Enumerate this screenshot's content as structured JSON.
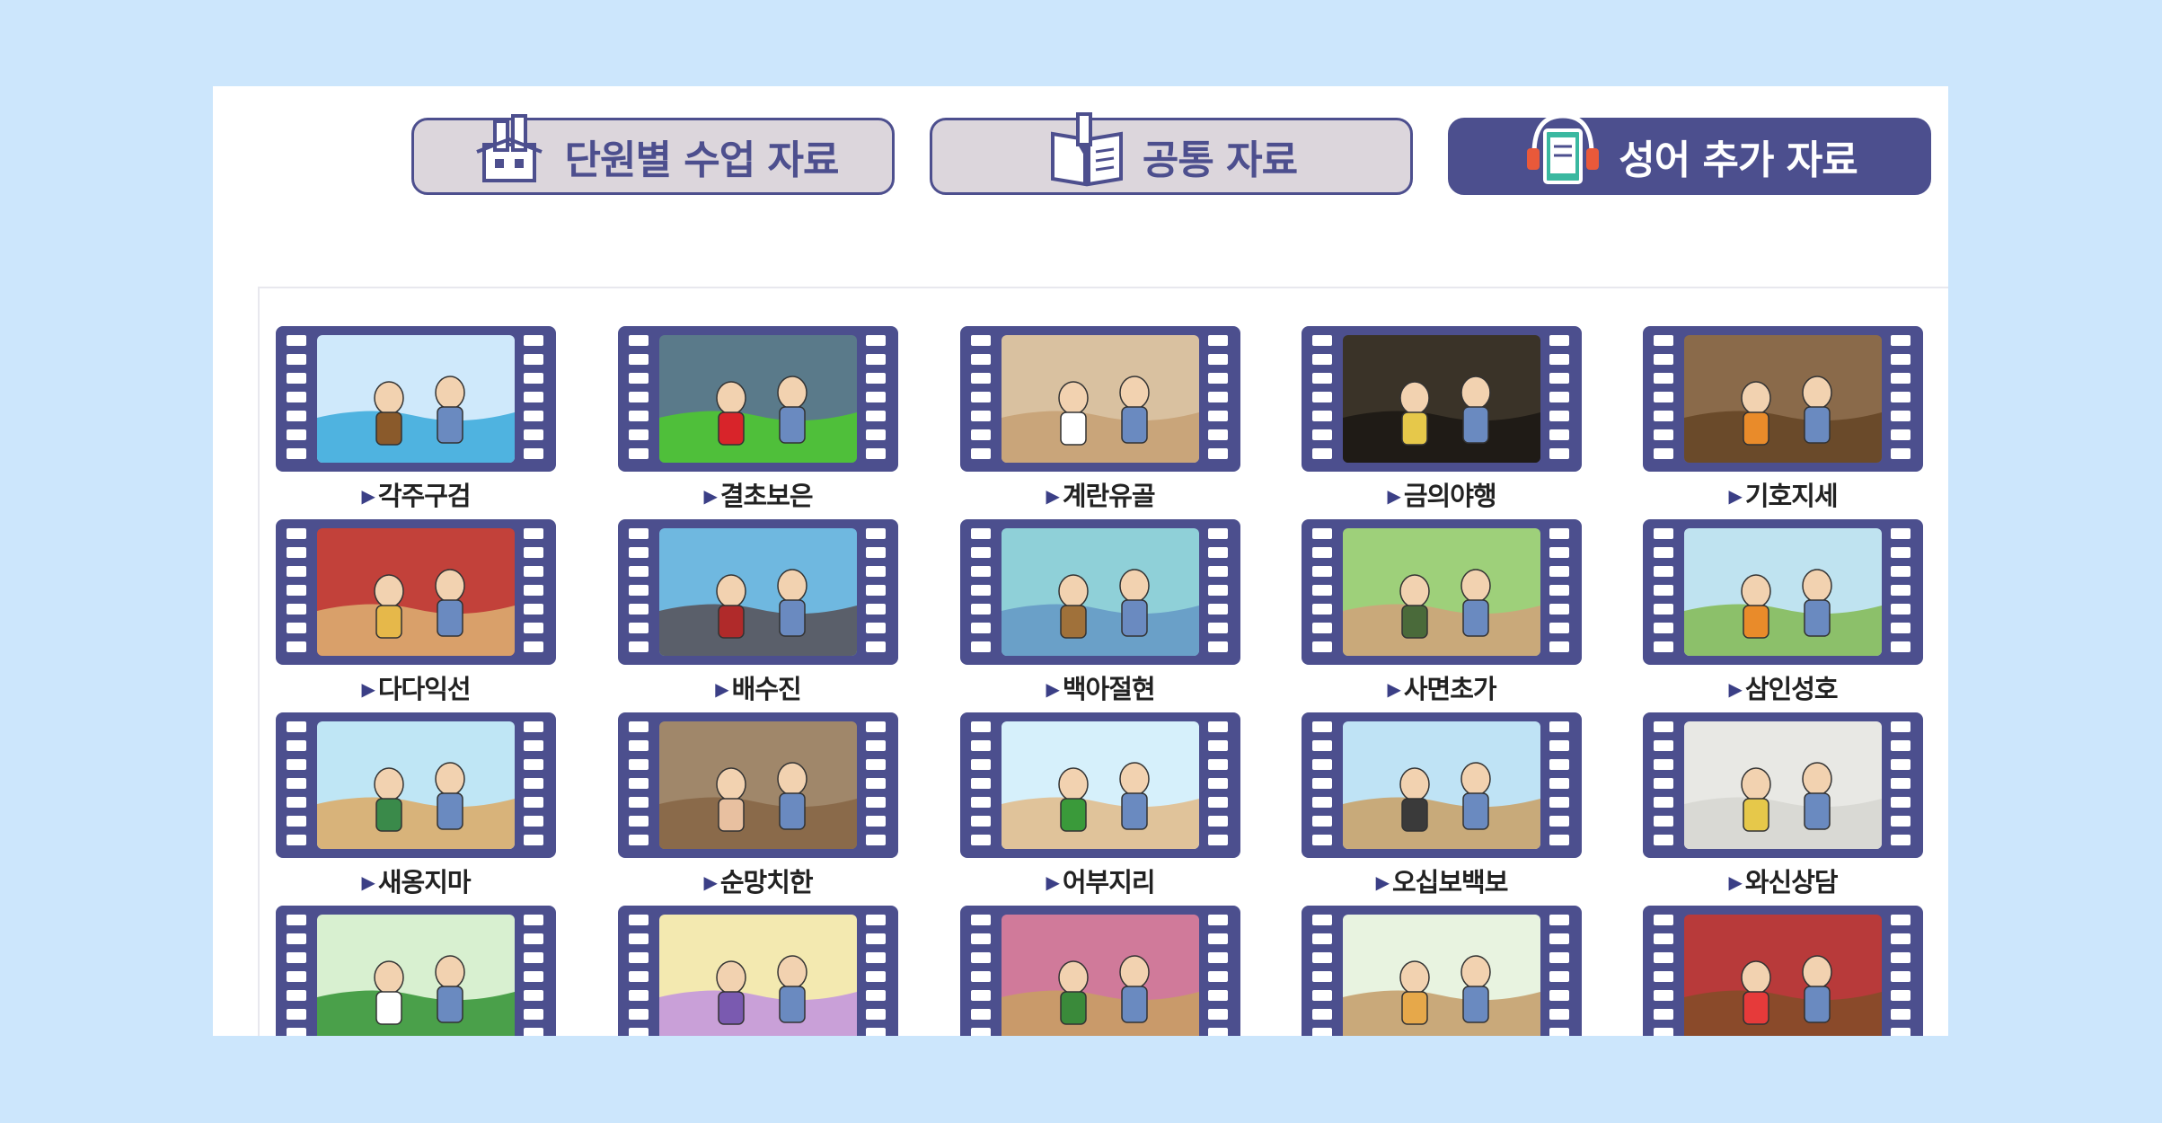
{
  "tabs": [
    {
      "label": "단원별 수업 자료",
      "active": false,
      "icon": "building-icon"
    },
    {
      "label": "공통 자료",
      "active": false,
      "icon": "book-pen-icon"
    },
    {
      "label": "성어 추가 자료",
      "active": true,
      "icon": "audiobook-headphone-icon"
    }
  ],
  "items": [
    {
      "label": "각주구검",
      "scene": {
        "sky": "#cfe9fb",
        "ground": "#4fb3e0",
        "accent": "#8a5a2b"
      }
    },
    {
      "label": "결초보은",
      "scene": {
        "sky": "#5a7a8a",
        "ground": "#4fbf3a",
        "accent": "#d8242a"
      }
    },
    {
      "label": "계란유골",
      "scene": {
        "sky": "#d9c1a0",
        "ground": "#c9a57a",
        "accent": "#ffffff"
      }
    },
    {
      "label": "금의야행",
      "scene": {
        "sky": "#3a3328",
        "ground": "#1f1b16",
        "accent": "#e6c84a"
      }
    },
    {
      "label": "기호지세",
      "scene": {
        "sky": "#8a6a4a",
        "ground": "#6a4a2a",
        "accent": "#e98b2a"
      }
    },
    {
      "label": "다다익선",
      "scene": {
        "sky": "#c2413a",
        "ground": "#d9a06a",
        "accent": "#e6b84a"
      }
    },
    {
      "label": "배수진",
      "scene": {
        "sky": "#6fb8e0",
        "ground": "#5a5f6a",
        "accent": "#b02a2a"
      }
    },
    {
      "label": "백아절현",
      "scene": {
        "sky": "#8fd0d8",
        "ground": "#6aa0c8",
        "accent": "#a0713a"
      }
    },
    {
      "label": "사면초가",
      "scene": {
        "sky": "#9ed07a",
        "ground": "#c9a97a",
        "accent": "#4a6a3a"
      }
    },
    {
      "label": "삼인성호",
      "scene": {
        "sky": "#bfe3f0",
        "ground": "#8cc06a",
        "accent": "#e98b2a"
      }
    },
    {
      "label": "새옹지마",
      "scene": {
        "sky": "#bfe6f5",
        "ground": "#d8b37a",
        "accent": "#3a8a4a"
      }
    },
    {
      "label": "순망치한",
      "scene": {
        "sky": "#a0876a",
        "ground": "#8a6a4a",
        "accent": "#e8c0a0"
      }
    },
    {
      "label": "어부지리",
      "scene": {
        "sky": "#d6f0fb",
        "ground": "#e0c39a",
        "accent": "#3a9a3a"
      }
    },
    {
      "label": "오십보백보",
      "scene": {
        "sky": "#bfe3f5",
        "ground": "#c8aa7a",
        "accent": "#3a3a3a"
      }
    },
    {
      "label": "와신상담",
      "scene": {
        "sky": "#e8e8e4",
        "ground": "#d9d9d4",
        "accent": "#e6c84a"
      }
    },
    {
      "label": "",
      "scene": {
        "sky": "#d8f0d0",
        "ground": "#4aa04a",
        "accent": "#ffffff"
      }
    },
    {
      "label": "",
      "scene": {
        "sky": "#f3e9b0",
        "ground": "#c9a0d8",
        "accent": "#7a5ab0"
      }
    },
    {
      "label": "",
      "scene": {
        "sky": "#d07a9a",
        "ground": "#c99a6a",
        "accent": "#3a8a3a"
      }
    },
    {
      "label": "",
      "scene": {
        "sky": "#e8f3e0",
        "ground": "#c9a97a",
        "accent": "#e6a84a"
      }
    },
    {
      "label": "",
      "scene": {
        "sky": "#b83a3a",
        "ground": "#8a4a2a",
        "accent": "#e63a3a"
      }
    }
  ],
  "colors": {
    "page_bg": "#cce6fc",
    "film": "#4c4f8e",
    "tab_inactive_bg": "#dcd6dc",
    "tab_active_bg": "#4c4f8e"
  }
}
